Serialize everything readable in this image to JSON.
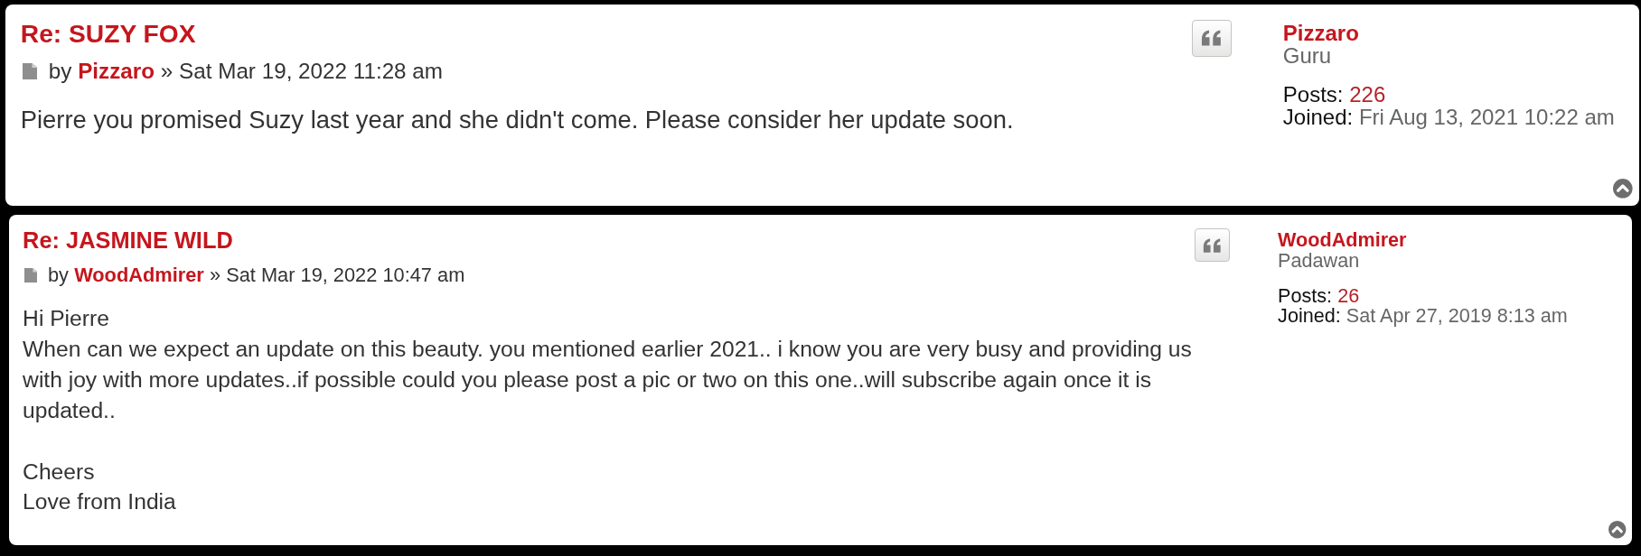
{
  "posts": [
    {
      "title": "Re: SUZY FOX",
      "meta": {
        "by": "by",
        "author": "Pizzaro",
        "separator": "»",
        "date": "Sat Mar 19, 2022 11:28 am"
      },
      "body": "Pierre you promised Suzy last year and she didn't come. Please consider her update soon.",
      "profile": {
        "username": "Pizzaro",
        "rank": "Guru",
        "posts_label": "Posts:",
        "posts": "226",
        "joined_label": "Joined:",
        "joined": "Fri Aug 13, 2021 10:22 am"
      }
    },
    {
      "title": "Re: JASMINE WILD",
      "meta": {
        "by": "by",
        "author": "WoodAdmirer",
        "separator": "»",
        "date": "Sat Mar 19, 2022 10:47 am"
      },
      "body": "Hi Pierre\nWhen can we expect an update on this beauty. you mentioned earlier 2021.. i know you are very busy and providing us with joy with more updates..if possible could you please post a pic or two on this one..will subscribe again once it is updated..\n\nCheers\nLove from India",
      "profile": {
        "username": "WoodAdmirer",
        "rank": "Padawan",
        "posts_label": "Posts:",
        "posts": "26",
        "joined_label": "Joined:",
        "joined": "Sat Apr 27, 2019 8:13 am"
      }
    }
  ]
}
